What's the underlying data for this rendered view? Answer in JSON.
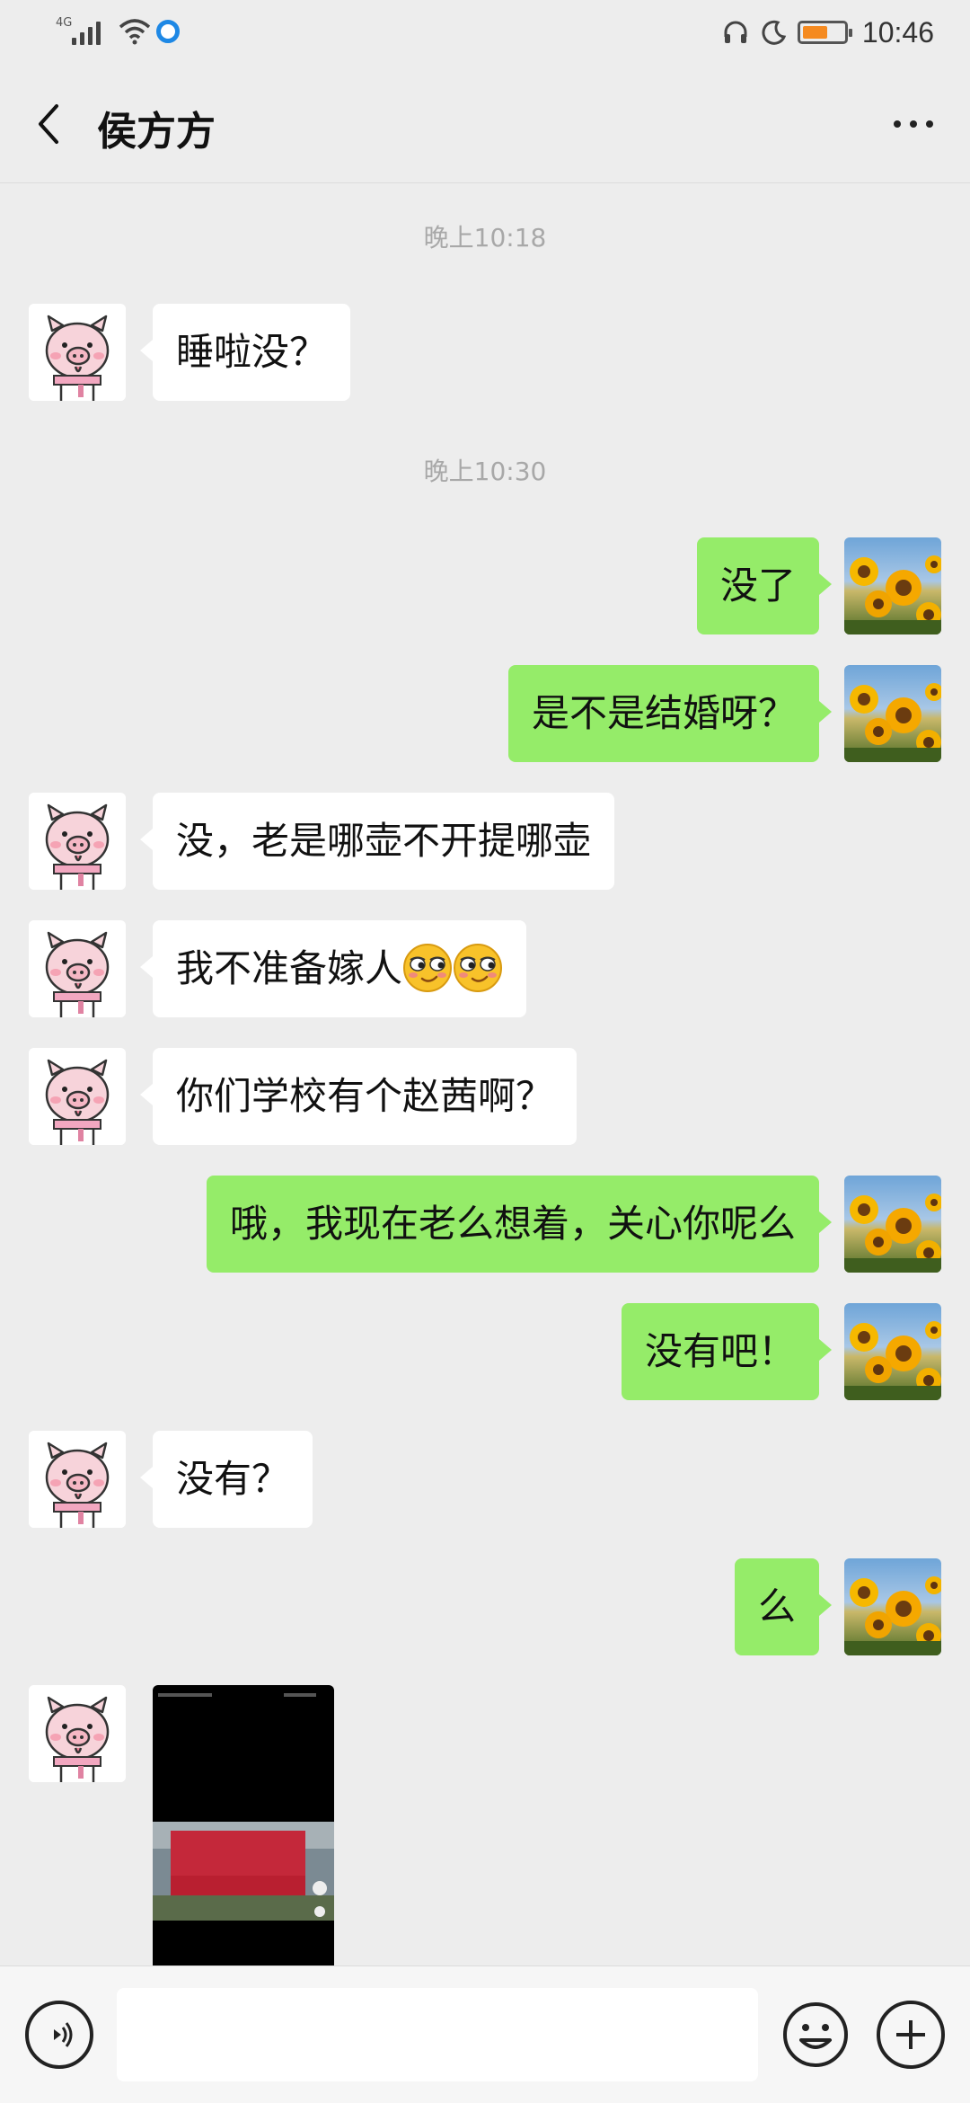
{
  "status_bar": {
    "network": "4G",
    "time": "10:46"
  },
  "header": {
    "title": "侯方方"
  },
  "chat": {
    "timestamps": [
      "晚上10:18",
      "晚上10:30"
    ],
    "messages": [
      {
        "side": "left",
        "text": "睡啦没？"
      },
      {
        "side": "right",
        "text": "没了"
      },
      {
        "side": "right",
        "text": "是不是结婚呀？"
      },
      {
        "side": "left",
        "text": "没，老是哪壶不开提哪壶"
      },
      {
        "side": "left",
        "text": "我不准备嫁人"
      },
      {
        "side": "left",
        "text": "你们学校有个赵茜啊？"
      },
      {
        "side": "right",
        "text": "哦，我现在老么想着，关心你呢么"
      },
      {
        "side": "right",
        "text": "没有吧！"
      },
      {
        "side": "left",
        "text": "没有？"
      },
      {
        "side": "right",
        "text": "么"
      }
    ],
    "video_message": {
      "side": "left",
      "thumbnail": "screen-recording-thumbnail"
    }
  },
  "input_bar": {
    "placeholder": ""
  },
  "colors": {
    "background": "#ededed",
    "sent_bubble": "#95ec69",
    "received_bubble": "#ffffff",
    "timestamp": "#a8a8a8"
  }
}
